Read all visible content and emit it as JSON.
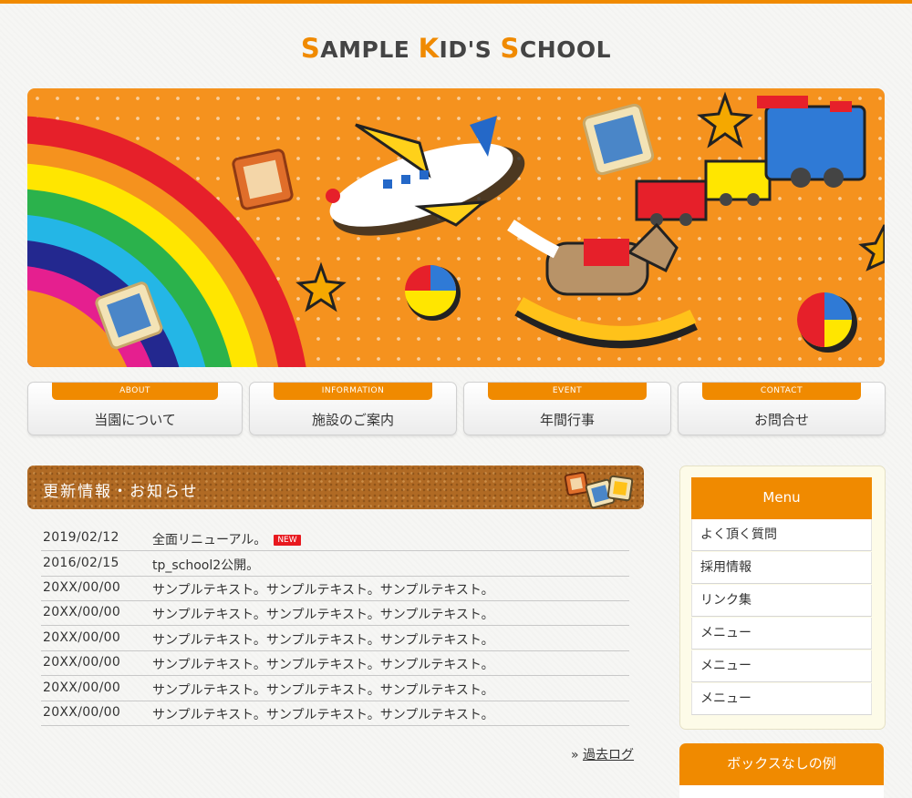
{
  "site": {
    "logo": [
      {
        "t": "S",
        "accent": true
      },
      {
        "t": "AMPLE ",
        "accent": false
      },
      {
        "t": "K",
        "accent": true
      },
      {
        "t": "ID'S ",
        "accent": false
      },
      {
        "t": "S",
        "accent": true
      },
      {
        "t": "CHOOL",
        "accent": false
      }
    ]
  },
  "colors": {
    "accent": "#f08a00",
    "hero_bg": "#f5921e",
    "badge": "#e8191f",
    "cork": "#b06a24"
  },
  "nav": [
    {
      "tag": "ABOUT",
      "label": "当園について"
    },
    {
      "tag": "INFORMATION",
      "label": "施設のご案内"
    },
    {
      "tag": "EVENT",
      "label": "年間行事"
    },
    {
      "tag": "CONTACT",
      "label": "お問合せ"
    }
  ],
  "news": {
    "title": "更新情報・お知らせ",
    "new_badge": "NEW",
    "items": [
      {
        "date": "2019/02/12",
        "text": "全面リニューアル。"
      },
      {
        "date": "2016/02/15",
        "text": "tp_school2公開。"
      },
      {
        "date": "20XX/00/00",
        "text": "サンプルテキスト。サンプルテキスト。サンプルテキスト。"
      },
      {
        "date": "20XX/00/00",
        "text": "サンプルテキスト。サンプルテキスト。サンプルテキスト。"
      },
      {
        "date": "20XX/00/00",
        "text": "サンプルテキスト。サンプルテキスト。サンプルテキスト。"
      },
      {
        "date": "20XX/00/00",
        "text": "サンプルテキスト。サンプルテキスト。サンプルテキスト。"
      },
      {
        "date": "20XX/00/00",
        "text": "サンプルテキスト。サンプルテキスト。サンプルテキスト。"
      },
      {
        "date": "20XX/00/00",
        "text": "サンプルテキスト。サンプルテキスト。サンプルテキスト。"
      }
    ],
    "past_log_prefix": "»",
    "past_log": "過去ログ"
  },
  "sidebar": {
    "menu_title": "Menu",
    "items": [
      "よく頂く質問",
      "採用情報",
      "リンク集",
      "メニュー",
      "メニュー",
      "メニュー"
    ],
    "box2_title": "ボックスなしの例"
  }
}
